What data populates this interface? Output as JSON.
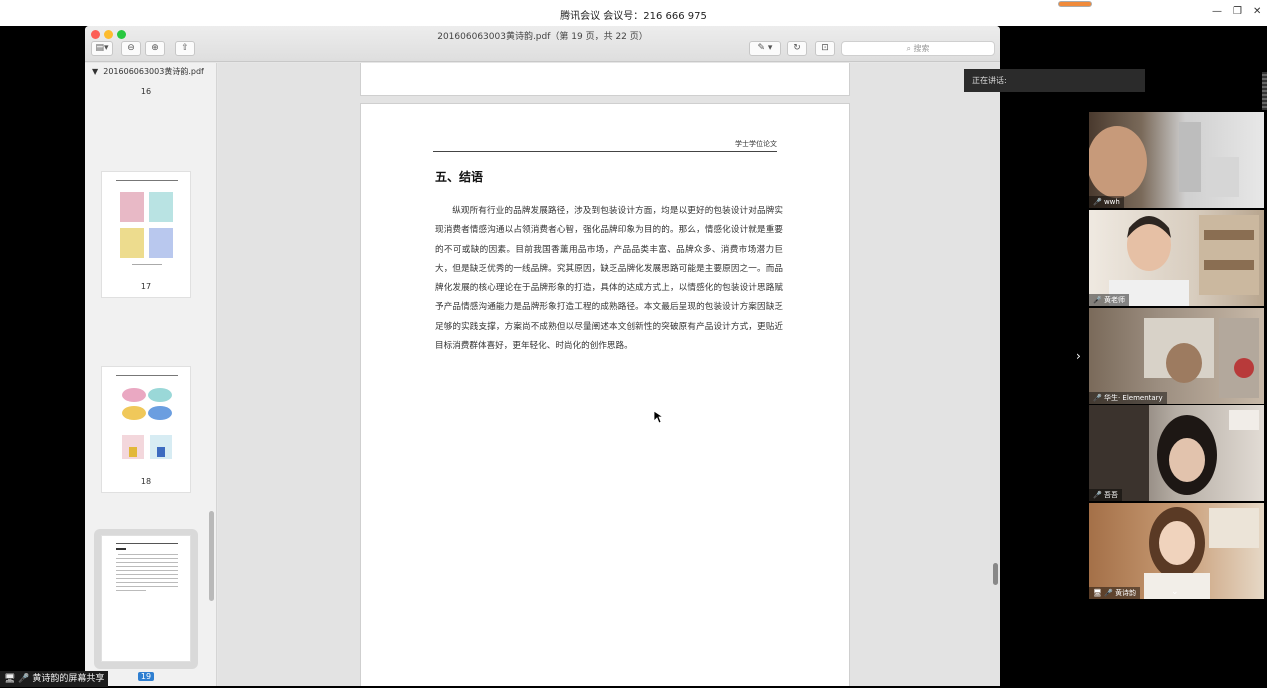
{
  "meeting": {
    "title": "腾讯会议 会议号：216 666 975",
    "speaking_label": "正在讲话:",
    "share_label": "黄诗韵的屏幕共享"
  },
  "pdf": {
    "doc_title": "201606063003黄诗韵.pdf（第 19 页，共 22 页）",
    "search_placeholder": "搜索",
    "sidebar_file": "201606063003黄诗韵.pdf",
    "pages": [
      "16",
      "17",
      "18",
      "19"
    ],
    "page_header": "学士学位论文",
    "section_title": "五、结语",
    "paragraph": "纵观所有行业的品牌发展路径，涉及到包装设计方面，均是以更好的包装设计对品牌实现消费者情感沟通以占领消费者心智，强化品牌印象为目的的。那么，情感化设计就是重要的不可或缺的因素。目前我国香薰用品市场，产品品类丰富、品牌众多、消费市场潜力巨大，但是缺乏优秀的一线品牌。究其原因，缺乏品牌化发展思路可能是主要原因之一。而品牌化发展的核心理论在于品牌形象的打造，具体的达成方式上，以情感化的包装设计思路赋予产品情感沟通能力是品牌形象打造工程的成熟路径。本文最后呈现的包装设计方案因缺乏足够的实践支撑，方案尚不成熟但以尽量阐述本文创新性的突破原有产品设计方式，更贴近目标消费群体喜好，更年轻化、时尚化的创作思路。"
  },
  "participants": [
    {
      "name": "wwh"
    },
    {
      "name": "黄老师"
    },
    {
      "name": "华生· Elementary"
    },
    {
      "name": "吾吾"
    },
    {
      "name": "黄诗韵"
    }
  ],
  "colors": {
    "accent": "#2f7fd1"
  }
}
